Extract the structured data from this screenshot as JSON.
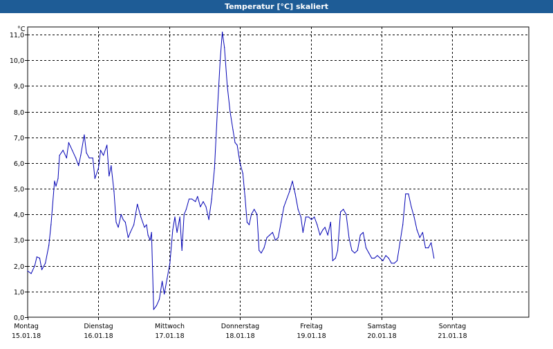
{
  "window": {
    "title": "Temperatur [°C] skaliert"
  },
  "colors": {
    "title_bar": "#1e5c96",
    "series_line": "#0000b4",
    "grid": "#000000"
  },
  "chart_data": {
    "type": "line",
    "title": "Temperatur [°C] skaliert",
    "ylabel": "°C",
    "xlabel": "",
    "ylim": [
      0,
      11.3
    ],
    "xlim": [
      0,
      7
    ],
    "grid": true,
    "yticks": [
      0.0,
      1.0,
      2.0,
      3.0,
      4.0,
      5.0,
      6.0,
      7.0,
      8.0,
      9.0,
      10.0,
      11.0
    ],
    "ytick_labels": [
      "0,0",
      "1,0",
      "2,0",
      "3,0",
      "4,0",
      "5,0",
      "6,0",
      "7,0",
      "8,0",
      "9,0",
      "10,0",
      "11,0"
    ],
    "xticks": [
      {
        "x": 0,
        "day": "Montag",
        "date": "15.01.18"
      },
      {
        "x": 1,
        "day": "Dienstag",
        "date": "16.01.18"
      },
      {
        "x": 2,
        "day": "Mittwoch",
        "date": "17.01.18"
      },
      {
        "x": 3,
        "day": "Donnerstag",
        "date": "18.01.18"
      },
      {
        "x": 4,
        "day": "Freitag",
        "date": "19.01.18"
      },
      {
        "x": 5,
        "day": "Samstag",
        "date": "20.01.18"
      },
      {
        "x": 6,
        "day": "Sonntag",
        "date": "21.01.18"
      }
    ],
    "series": [
      {
        "points": [
          [
            0.0,
            1.8
          ],
          [
            0.05,
            1.7
          ],
          [
            0.1,
            2.0
          ],
          [
            0.13,
            2.35
          ],
          [
            0.17,
            2.3
          ],
          [
            0.2,
            1.85
          ],
          [
            0.25,
            2.1
          ],
          [
            0.3,
            2.8
          ],
          [
            0.33,
            3.6
          ],
          [
            0.38,
            5.3
          ],
          [
            0.4,
            5.1
          ],
          [
            0.43,
            5.4
          ],
          [
            0.45,
            6.3
          ],
          [
            0.5,
            6.5
          ],
          [
            0.55,
            6.2
          ],
          [
            0.58,
            6.8
          ],
          [
            0.63,
            6.5
          ],
          [
            0.68,
            6.2
          ],
          [
            0.72,
            5.9
          ],
          [
            0.75,
            6.3
          ],
          [
            0.8,
            7.1
          ],
          [
            0.83,
            6.4
          ],
          [
            0.87,
            6.2
          ],
          [
            0.92,
            6.2
          ],
          [
            0.95,
            5.4
          ],
          [
            1.0,
            5.8
          ],
          [
            1.03,
            6.5
          ],
          [
            1.07,
            6.3
          ],
          [
            1.12,
            6.7
          ],
          [
            1.15,
            5.5
          ],
          [
            1.18,
            5.9
          ],
          [
            1.22,
            4.9
          ],
          [
            1.25,
            3.7
          ],
          [
            1.28,
            3.5
          ],
          [
            1.32,
            4.0
          ],
          [
            1.35,
            3.8
          ],
          [
            1.38,
            3.7
          ],
          [
            1.42,
            3.1
          ],
          [
            1.45,
            3.3
          ],
          [
            1.5,
            3.6
          ],
          [
            1.55,
            4.4
          ],
          [
            1.6,
            3.9
          ],
          [
            1.65,
            3.5
          ],
          [
            1.68,
            3.6
          ],
          [
            1.7,
            3.2
          ],
          [
            1.73,
            3.0
          ],
          [
            1.75,
            3.3
          ],
          [
            1.78,
            0.3
          ],
          [
            1.82,
            0.45
          ],
          [
            1.86,
            0.7
          ],
          [
            1.9,
            1.4
          ],
          [
            1.93,
            0.9
          ],
          [
            1.97,
            1.5
          ],
          [
            2.01,
            2.1
          ],
          [
            2.05,
            3.4
          ],
          [
            2.08,
            3.9
          ],
          [
            2.11,
            3.3
          ],
          [
            2.15,
            3.9
          ],
          [
            2.18,
            2.6
          ],
          [
            2.21,
            4.0
          ],
          [
            2.24,
            4.2
          ],
          [
            2.28,
            4.6
          ],
          [
            2.32,
            4.6
          ],
          [
            2.37,
            4.5
          ],
          [
            2.4,
            4.7
          ],
          [
            2.44,
            4.3
          ],
          [
            2.48,
            4.5
          ],
          [
            2.52,
            4.3
          ],
          [
            2.56,
            3.8
          ],
          [
            2.6,
            4.6
          ],
          [
            2.64,
            5.8
          ],
          [
            2.68,
            8.0
          ],
          [
            2.72,
            10.0
          ],
          [
            2.75,
            11.1
          ],
          [
            2.78,
            10.5
          ],
          [
            2.82,
            9.0
          ],
          [
            2.86,
            8.0
          ],
          [
            2.9,
            7.3
          ],
          [
            2.93,
            6.8
          ],
          [
            2.96,
            6.7
          ],
          [
            3.0,
            6.0
          ],
          [
            3.04,
            5.6
          ],
          [
            3.07,
            4.7
          ],
          [
            3.1,
            3.7
          ],
          [
            3.13,
            3.6
          ],
          [
            3.16,
            4.0
          ],
          [
            3.2,
            4.2
          ],
          [
            3.24,
            4.0
          ],
          [
            3.27,
            2.6
          ],
          [
            3.3,
            2.5
          ],
          [
            3.34,
            2.7
          ],
          [
            3.38,
            3.1
          ],
          [
            3.42,
            3.2
          ],
          [
            3.46,
            3.3
          ],
          [
            3.5,
            3.0
          ],
          [
            3.54,
            3.1
          ],
          [
            3.58,
            3.7
          ],
          [
            3.62,
            4.3
          ],
          [
            3.66,
            4.6
          ],
          [
            3.7,
            4.9
          ],
          [
            3.74,
            5.3
          ],
          [
            3.78,
            4.8
          ],
          [
            3.82,
            4.2
          ],
          [
            3.86,
            3.9
          ],
          [
            3.89,
            3.3
          ],
          [
            3.93,
            3.9
          ],
          [
            3.97,
            3.9
          ],
          [
            4.01,
            3.8
          ],
          [
            4.05,
            3.9
          ],
          [
            4.09,
            3.6
          ],
          [
            4.13,
            3.2
          ],
          [
            4.17,
            3.4
          ],
          [
            4.2,
            3.5
          ],
          [
            4.24,
            3.2
          ],
          [
            4.28,
            3.7
          ],
          [
            4.31,
            2.2
          ],
          [
            4.35,
            2.3
          ],
          [
            4.38,
            2.6
          ],
          [
            4.42,
            4.1
          ],
          [
            4.46,
            4.2
          ],
          [
            4.5,
            4.0
          ],
          [
            4.54,
            3.1
          ],
          [
            4.58,
            2.6
          ],
          [
            4.62,
            2.5
          ],
          [
            4.66,
            2.6
          ],
          [
            4.7,
            3.2
          ],
          [
            4.74,
            3.3
          ],
          [
            4.78,
            2.7
          ],
          [
            4.82,
            2.5
          ],
          [
            4.86,
            2.3
          ],
          [
            4.9,
            2.3
          ],
          [
            4.94,
            2.4
          ],
          [
            4.98,
            2.3
          ],
          [
            5.02,
            2.2
          ],
          [
            5.06,
            2.4
          ],
          [
            5.1,
            2.3
          ],
          [
            5.14,
            2.1
          ],
          [
            5.18,
            2.1
          ],
          [
            5.22,
            2.2
          ],
          [
            5.26,
            2.9
          ],
          [
            5.3,
            3.6
          ],
          [
            5.34,
            4.8
          ],
          [
            5.38,
            4.8
          ],
          [
            5.42,
            4.3
          ],
          [
            5.46,
            3.9
          ],
          [
            5.5,
            3.4
          ],
          [
            5.54,
            3.1
          ],
          [
            5.58,
            3.3
          ],
          [
            5.62,
            2.7
          ],
          [
            5.66,
            2.7
          ],
          [
            5.7,
            2.9
          ],
          [
            5.74,
            2.3
          ]
        ]
      }
    ]
  }
}
